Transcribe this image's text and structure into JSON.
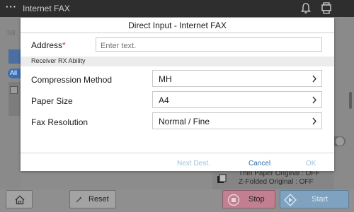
{
  "topbar": {
    "title": "Internet FAX",
    "menu_icon": "more-dots-icon",
    "icons": [
      "bell-icon",
      "device-status-icon"
    ]
  },
  "background": {
    "search_fragment": "sa",
    "all_pill": "All",
    "info_line1": "Thin Paper Original : OFF",
    "info_line2": "Z-Folded Original : OFF"
  },
  "dialog": {
    "title": "Direct Input - Internet FAX",
    "address": {
      "label": "Address",
      "required_mark": "*",
      "value": "",
      "placeholder": "Enter text."
    },
    "section_header": "Receiver RX Ability",
    "rows": [
      {
        "label": "Compression Method",
        "value": "MH"
      },
      {
        "label": "Paper Size",
        "value": "A4"
      },
      {
        "label": "Fax Resolution",
        "value": "Normal / Fine"
      }
    ],
    "footer": {
      "next_dest": "Next Dest.",
      "cancel": "Cancel",
      "ok": "OK"
    }
  },
  "bottombar": {
    "home_icon": "home-icon",
    "reset_label": "Reset",
    "stop_label": "Stop",
    "start_label": "Start"
  },
  "colors": {
    "stop_button": "#c27f92",
    "start_button": "#7ea2bf",
    "link_active": "#2f6fa8",
    "link_disabled": "#9bc2de",
    "required": "#d9322b"
  }
}
